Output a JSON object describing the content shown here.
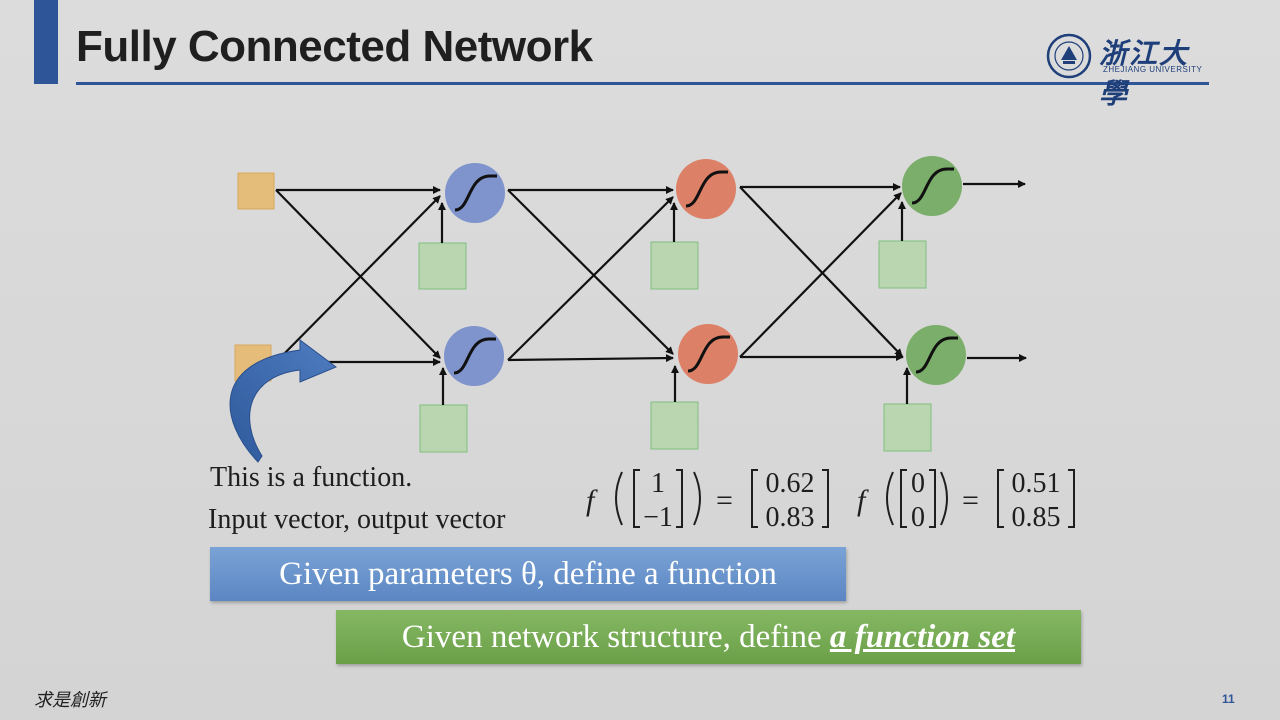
{
  "slide": {
    "title": "Fully Connected Network",
    "logo_text_cn": "浙江大學",
    "logo_text_en": "ZHEJIANG UNIVERSITY",
    "caption_line1": "This is a function.",
    "caption_line2": "Input vector, output vector",
    "equation1": {
      "f": "f",
      "input": [
        "1",
        "−1"
      ],
      "output": [
        "0.62",
        "0.83"
      ]
    },
    "equation2": {
      "f": "f",
      "input": [
        "0",
        "0"
      ],
      "output": [
        "0.51",
        "0.85"
      ]
    },
    "banner_blue_text": "Given parameters θ, define a function",
    "banner_green_prefix": "Given network structure, define ",
    "banner_green_emphasis": "a function set",
    "footer_motto": "求是創新",
    "page_number": "11"
  },
  "colors": {
    "accent": "#2e5597",
    "input_node": "#e8b86a",
    "bias_box": "#b9d6b0",
    "layer1_neuron": "#7f93cc",
    "layer2_neuron": "#dd8068",
    "layer3_neuron": "#7aae6a",
    "banner_blue": "#6a94cc",
    "banner_green": "#78ac55"
  },
  "diagram": {
    "icons": [
      "sigmoid-icon",
      "curved-arrow-icon"
    ]
  }
}
